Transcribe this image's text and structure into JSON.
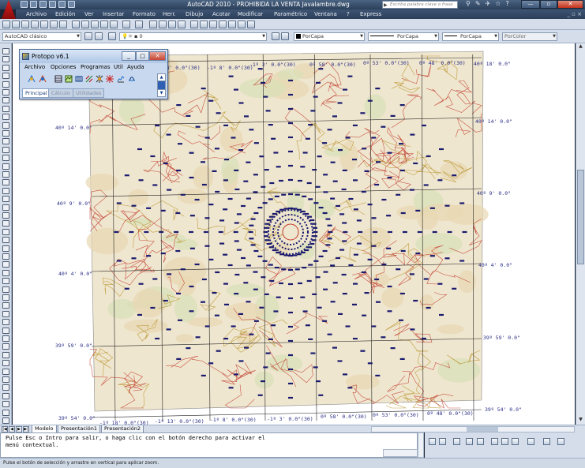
{
  "window": {
    "title": "AutoCAD 2010 - PROHIBIDA LA VENTA    Javalambre.dwg",
    "search_placeholder": "Escriba palabra clave o frase"
  },
  "menubar": {
    "items": [
      "Archivo",
      "Edición",
      "Ver",
      "Insertar",
      "Formato",
      "Herr.",
      "Dibujo",
      "Acotar",
      "Modificar",
      "Paramétrico",
      "Ventana",
      "?",
      "Express"
    ],
    "doc_controls": "_ ▫ ×"
  },
  "toolbar2": {
    "workspace": "AutoCAD clásico",
    "layer": "0",
    "color": "PorCapa",
    "linetype": "PorCapa",
    "lineweight": "PorCapa",
    "plotstyle": "PorColor"
  },
  "protopo": {
    "title": "Protopo v6.1",
    "menu": [
      "Archivo",
      "Opciones",
      "Programas",
      "Util",
      "Ayuda"
    ],
    "tabs": [
      "Principal",
      "Cálculo",
      "Utilidades"
    ]
  },
  "map": {
    "top_labels": [
      "-1º 18' 0.0\"(30)",
      "-1º 8' 0.0\"(30)",
      "-1º 3' 0.0\"(30)",
      "0º 58' 0.0\"(30)",
      "0º 53' 0.0\"(30)",
      "0º 48' 0.0\"(30)",
      "40º 18' 0.0\""
    ],
    "bottom_labels": [
      "-1º 18' 0.0\"(30)",
      "-1º 13' 0.0\"(30)",
      "-1º 8' 0.0\"(30)",
      "-1º 3' 0.0\"(30)",
      "0º 58' 0.0\"(30)",
      "0º 53' 0.0\"(30)",
      "0º 48' 0.0\"(30)"
    ],
    "left_labels": [
      "40º 14' 0.0\"",
      "40º 9' 0.0\"",
      "40º 4' 0.0\"",
      "39º 59' 0.0\"",
      "39º 54' 0.0\""
    ],
    "right_labels": [
      "40º 14' 0.0\"",
      "40º 9' 0.0\"",
      "40º 4' 0.0\"",
      "39º 59' 0.0\"",
      "39º 54' 0.0\""
    ],
    "colors": {
      "contour": "#c0392b",
      "contour_alt": "#b9932a",
      "grid": "#222222",
      "label": "#2b2f86",
      "markers": "#1a1a6e"
    }
  },
  "layout_tabs": [
    "Modelo",
    "Presentación1",
    "Presentación2"
  ],
  "command_line": {
    "line1": "Pulse Esc o Intro para salir, o haga clic con el botón derecho para activar el",
    "line2": "menú contextual."
  },
  "status": {
    "text": "Pulse el botón de selección y arrastre en vertical para aplicar zoom."
  }
}
